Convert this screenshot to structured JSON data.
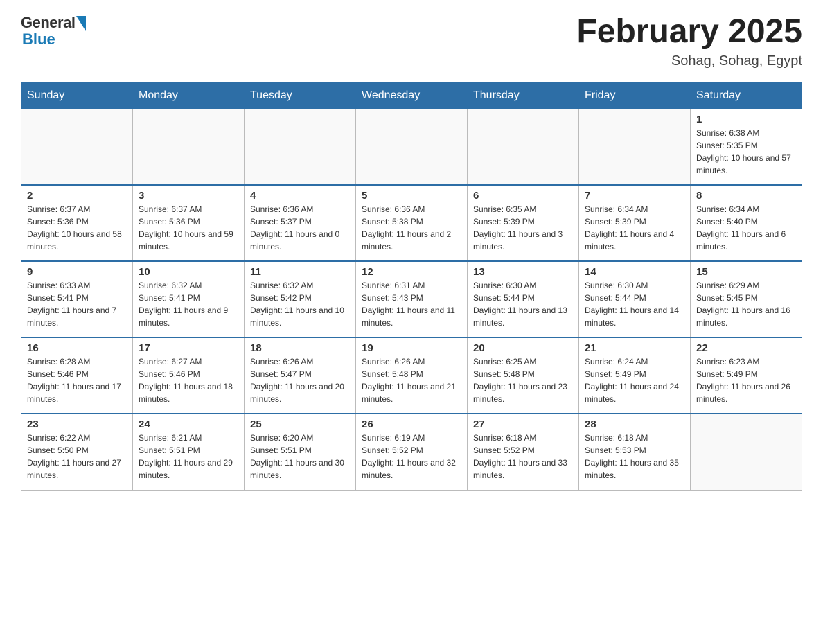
{
  "header": {
    "logo_general": "General",
    "logo_blue": "Blue",
    "month_title": "February 2025",
    "subtitle": "Sohag, Sohag, Egypt"
  },
  "days_of_week": [
    "Sunday",
    "Monday",
    "Tuesday",
    "Wednesday",
    "Thursday",
    "Friday",
    "Saturday"
  ],
  "weeks": [
    [
      {
        "day": "",
        "info": ""
      },
      {
        "day": "",
        "info": ""
      },
      {
        "day": "",
        "info": ""
      },
      {
        "day": "",
        "info": ""
      },
      {
        "day": "",
        "info": ""
      },
      {
        "day": "",
        "info": ""
      },
      {
        "day": "1",
        "info": "Sunrise: 6:38 AM\nSunset: 5:35 PM\nDaylight: 10 hours and 57 minutes."
      }
    ],
    [
      {
        "day": "2",
        "info": "Sunrise: 6:37 AM\nSunset: 5:36 PM\nDaylight: 10 hours and 58 minutes."
      },
      {
        "day": "3",
        "info": "Sunrise: 6:37 AM\nSunset: 5:36 PM\nDaylight: 10 hours and 59 minutes."
      },
      {
        "day": "4",
        "info": "Sunrise: 6:36 AM\nSunset: 5:37 PM\nDaylight: 11 hours and 0 minutes."
      },
      {
        "day": "5",
        "info": "Sunrise: 6:36 AM\nSunset: 5:38 PM\nDaylight: 11 hours and 2 minutes."
      },
      {
        "day": "6",
        "info": "Sunrise: 6:35 AM\nSunset: 5:39 PM\nDaylight: 11 hours and 3 minutes."
      },
      {
        "day": "7",
        "info": "Sunrise: 6:34 AM\nSunset: 5:39 PM\nDaylight: 11 hours and 4 minutes."
      },
      {
        "day": "8",
        "info": "Sunrise: 6:34 AM\nSunset: 5:40 PM\nDaylight: 11 hours and 6 minutes."
      }
    ],
    [
      {
        "day": "9",
        "info": "Sunrise: 6:33 AM\nSunset: 5:41 PM\nDaylight: 11 hours and 7 minutes."
      },
      {
        "day": "10",
        "info": "Sunrise: 6:32 AM\nSunset: 5:41 PM\nDaylight: 11 hours and 9 minutes."
      },
      {
        "day": "11",
        "info": "Sunrise: 6:32 AM\nSunset: 5:42 PM\nDaylight: 11 hours and 10 minutes."
      },
      {
        "day": "12",
        "info": "Sunrise: 6:31 AM\nSunset: 5:43 PM\nDaylight: 11 hours and 11 minutes."
      },
      {
        "day": "13",
        "info": "Sunrise: 6:30 AM\nSunset: 5:44 PM\nDaylight: 11 hours and 13 minutes."
      },
      {
        "day": "14",
        "info": "Sunrise: 6:30 AM\nSunset: 5:44 PM\nDaylight: 11 hours and 14 minutes."
      },
      {
        "day": "15",
        "info": "Sunrise: 6:29 AM\nSunset: 5:45 PM\nDaylight: 11 hours and 16 minutes."
      }
    ],
    [
      {
        "day": "16",
        "info": "Sunrise: 6:28 AM\nSunset: 5:46 PM\nDaylight: 11 hours and 17 minutes."
      },
      {
        "day": "17",
        "info": "Sunrise: 6:27 AM\nSunset: 5:46 PM\nDaylight: 11 hours and 18 minutes."
      },
      {
        "day": "18",
        "info": "Sunrise: 6:26 AM\nSunset: 5:47 PM\nDaylight: 11 hours and 20 minutes."
      },
      {
        "day": "19",
        "info": "Sunrise: 6:26 AM\nSunset: 5:48 PM\nDaylight: 11 hours and 21 minutes."
      },
      {
        "day": "20",
        "info": "Sunrise: 6:25 AM\nSunset: 5:48 PM\nDaylight: 11 hours and 23 minutes."
      },
      {
        "day": "21",
        "info": "Sunrise: 6:24 AM\nSunset: 5:49 PM\nDaylight: 11 hours and 24 minutes."
      },
      {
        "day": "22",
        "info": "Sunrise: 6:23 AM\nSunset: 5:49 PM\nDaylight: 11 hours and 26 minutes."
      }
    ],
    [
      {
        "day": "23",
        "info": "Sunrise: 6:22 AM\nSunset: 5:50 PM\nDaylight: 11 hours and 27 minutes."
      },
      {
        "day": "24",
        "info": "Sunrise: 6:21 AM\nSunset: 5:51 PM\nDaylight: 11 hours and 29 minutes."
      },
      {
        "day": "25",
        "info": "Sunrise: 6:20 AM\nSunset: 5:51 PM\nDaylight: 11 hours and 30 minutes."
      },
      {
        "day": "26",
        "info": "Sunrise: 6:19 AM\nSunset: 5:52 PM\nDaylight: 11 hours and 32 minutes."
      },
      {
        "day": "27",
        "info": "Sunrise: 6:18 AM\nSunset: 5:52 PM\nDaylight: 11 hours and 33 minutes."
      },
      {
        "day": "28",
        "info": "Sunrise: 6:18 AM\nSunset: 5:53 PM\nDaylight: 11 hours and 35 minutes."
      },
      {
        "day": "",
        "info": ""
      }
    ]
  ]
}
